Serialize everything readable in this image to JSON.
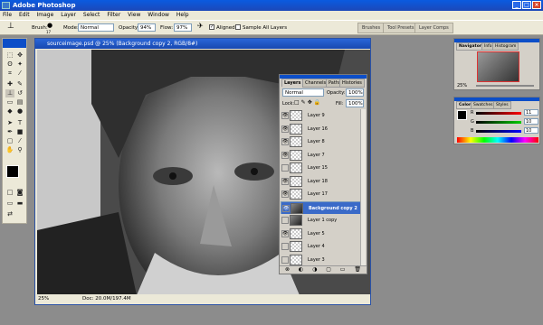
{
  "app": {
    "title": "Adobe Photoshop",
    "window_buttons": [
      "_",
      "□",
      "×"
    ]
  },
  "menu": [
    "File",
    "Edit",
    "Image",
    "Layer",
    "Select",
    "Filter",
    "View",
    "Window",
    "Help"
  ],
  "options": {
    "brush_label": "Brush:",
    "brush_size": "17",
    "mode_label": "Mode:",
    "mode_value": "Normal",
    "opacity_label": "Opacity:",
    "opacity_value": "94%",
    "flow_label": "Flow:",
    "flow_value": "97%",
    "aligned_label": "Aligned",
    "aligned_checked": "✓",
    "sample_all_label": "Sample All Layers",
    "palette_well": [
      "Brushes",
      "Tool Presets",
      "Layer Comps"
    ]
  },
  "document": {
    "title": "sourceimage.psd @ 25% (Background copy 2, RGB/8#)",
    "zoom": "25%",
    "doc_info": "Doc: 20.0M/197.4M"
  },
  "layers_panel": {
    "tabs": [
      "Layers",
      "Channels",
      "Paths",
      "Histories"
    ],
    "blend_mode": "Normal",
    "opacity_label": "Opacity:",
    "opacity_value": "100%",
    "lock_label": "Lock:",
    "fill_label": "Fill:",
    "fill_value": "100%",
    "layers": [
      {
        "name": "Layer 9",
        "visible": true,
        "selected": false,
        "photo": false
      },
      {
        "name": "Layer 16",
        "visible": true,
        "selected": false,
        "photo": false
      },
      {
        "name": "Layer 8",
        "visible": true,
        "selected": false,
        "photo": false
      },
      {
        "name": "Layer 7",
        "visible": true,
        "selected": false,
        "photo": false
      },
      {
        "name": "Layer 15",
        "visible": false,
        "selected": false,
        "photo": false
      },
      {
        "name": "Layer 18",
        "visible": true,
        "selected": false,
        "photo": false
      },
      {
        "name": "Layer 17",
        "visible": true,
        "selected": false,
        "photo": false
      },
      {
        "name": "Background copy 2",
        "visible": true,
        "selected": true,
        "photo": true
      },
      {
        "name": "Layer 1 copy",
        "visible": false,
        "selected": false,
        "photo": true
      },
      {
        "name": "Layer 5",
        "visible": true,
        "selected": false,
        "photo": false
      },
      {
        "name": "Layer 4",
        "visible": false,
        "selected": false,
        "photo": false
      },
      {
        "name": "Layer 3",
        "visible": false,
        "selected": false,
        "photo": false
      }
    ]
  },
  "navigator": {
    "tabs": [
      "Navigator",
      "Info",
      "Histogram"
    ],
    "zoom": "25%"
  },
  "color_panel": {
    "tabs": [
      "Color",
      "Swatches",
      "Styles"
    ],
    "r": "11",
    "g": "10",
    "b": "10"
  },
  "colors": {
    "titlebar": "#0a5be0",
    "panel": "#d4d0c8",
    "selection": "#3a6ac8",
    "workspace": "#8c8c8c"
  }
}
